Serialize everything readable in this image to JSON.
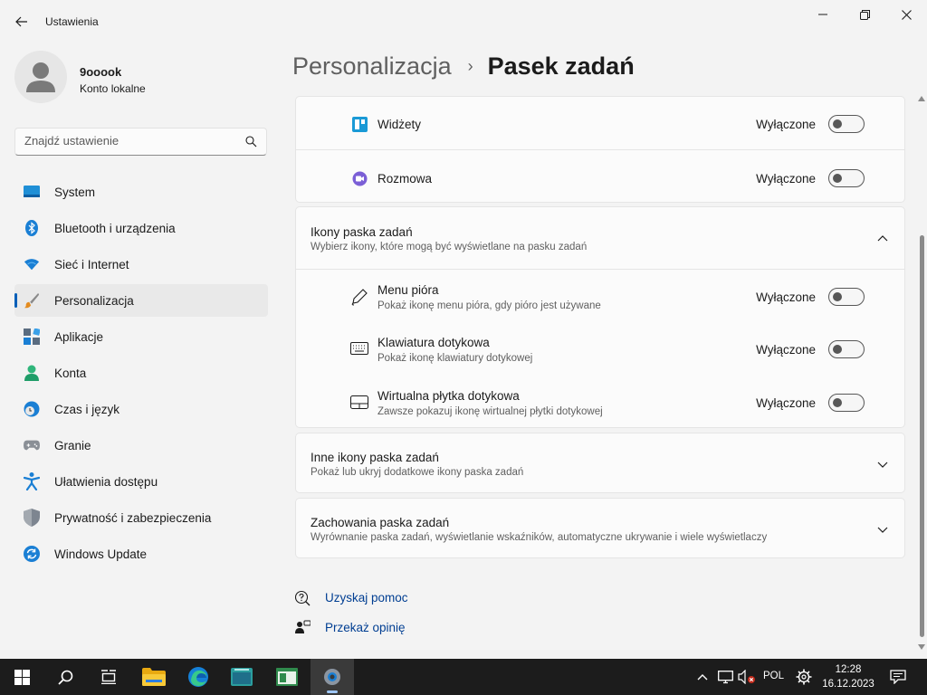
{
  "window": {
    "title": "Ustawienia"
  },
  "profile": {
    "name": "9ooook",
    "account_type": "Konto lokalne"
  },
  "search": {
    "placeholder": "Znajdź ustawienie"
  },
  "sidebar": {
    "items": [
      {
        "label": "System",
        "icon": "system-icon"
      },
      {
        "label": "Bluetooth i urządzenia",
        "icon": "bluetooth-icon"
      },
      {
        "label": "Sieć i Internet",
        "icon": "wifi-icon"
      },
      {
        "label": "Personalizacja",
        "icon": "brush-icon",
        "active": true
      },
      {
        "label": "Aplikacje",
        "icon": "apps-icon"
      },
      {
        "label": "Konta",
        "icon": "accounts-icon"
      },
      {
        "label": "Czas i język",
        "icon": "time-language-icon"
      },
      {
        "label": "Granie",
        "icon": "gamepad-icon"
      },
      {
        "label": "Ułatwienia dostępu",
        "icon": "accessibility-icon"
      },
      {
        "label": "Prywatność i zabezpieczenia",
        "icon": "shield-icon"
      },
      {
        "label": "Windows Update",
        "icon": "windows-update-icon"
      }
    ]
  },
  "breadcrumb": {
    "parent": "Personalizacja",
    "separator": "›",
    "current": "Pasek zadań"
  },
  "taskbar_items": {
    "widgets": {
      "label": "Widżety",
      "state": "Wyłączone",
      "on": false
    },
    "chat": {
      "label": "Rozmowa",
      "state": "Wyłączone",
      "on": false
    }
  },
  "taskbar_icons_section": {
    "title": "Ikony paska zadań",
    "subtitle": "Wybierz ikony, które mogą być wyświetlane na pasku zadań",
    "expanded": true,
    "items": [
      {
        "title": "Menu pióra",
        "subtitle": "Pokaż ikonę menu pióra, gdy pióro jest używane",
        "state": "Wyłączone",
        "on": false
      },
      {
        "title": "Klawiatura dotykowa",
        "subtitle": "Pokaż ikonę klawiatury dotykowej",
        "state": "Wyłączone",
        "on": false
      },
      {
        "title": "Wirtualna płytka dotykowa",
        "subtitle": "Zawsze pokazuj ikonę wirtualnej płytki dotykowej",
        "state": "Wyłączone",
        "on": false
      }
    ]
  },
  "other_icons_section": {
    "title": "Inne ikony paska zadań",
    "subtitle": "Pokaż lub ukryj dodatkowe ikony paska zadań"
  },
  "behaviors_section": {
    "title": "Zachowania paska zadań",
    "subtitle": "Wyrównanie paska zadań, wyświetlanie wskaźników, automatyczne ukrywanie i wiele wyświetlaczy"
  },
  "help": {
    "get_help": "Uzyskaj pomoc",
    "feedback": "Przekaż opinię"
  },
  "tray": {
    "language": "POL",
    "time": "12:28",
    "date": "16.12.2023"
  },
  "colors": {
    "accent": "#005fb8",
    "link": "#003e92",
    "taskbar": "#1c1c1c"
  }
}
